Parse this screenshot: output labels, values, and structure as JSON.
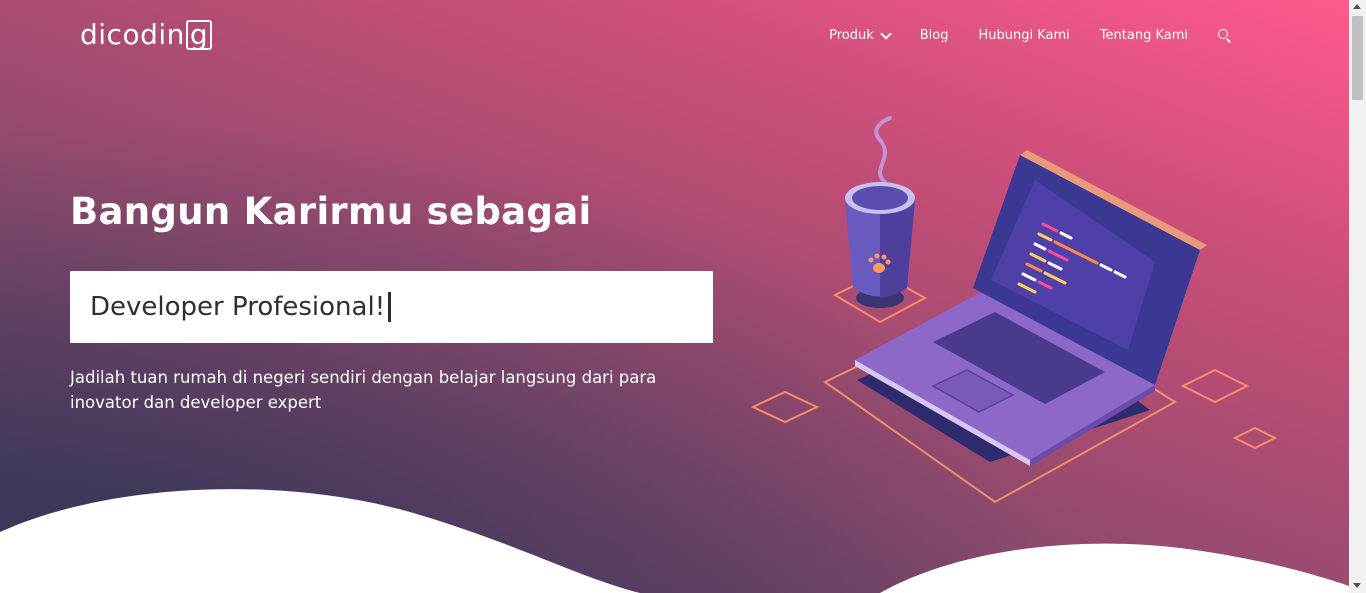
{
  "brand": {
    "logo_text": "dicodin",
    "logo_last_letter": "g"
  },
  "nav": {
    "items": [
      {
        "label": "Produk",
        "icon": "chevron-down-icon"
      },
      {
        "label": "Blog"
      },
      {
        "label": "Hubungi Kami"
      },
      {
        "label": "Tentang Kami"
      }
    ],
    "search_icon": "search-icon"
  },
  "hero": {
    "headline": "Bangun Karirmu sebagai",
    "typed_text": "Developer Profesional!",
    "subtitle": "Jadilah tuan rumah di negeri sendiri dengan belajar langsung dari para inovator dan developer expert"
  },
  "colors": {
    "gradient_top_right": "#ff5a8c",
    "gradient_bottom_left": "#3b3a5a",
    "text": "#ffffff",
    "typed_text": "#2b2f3a"
  }
}
